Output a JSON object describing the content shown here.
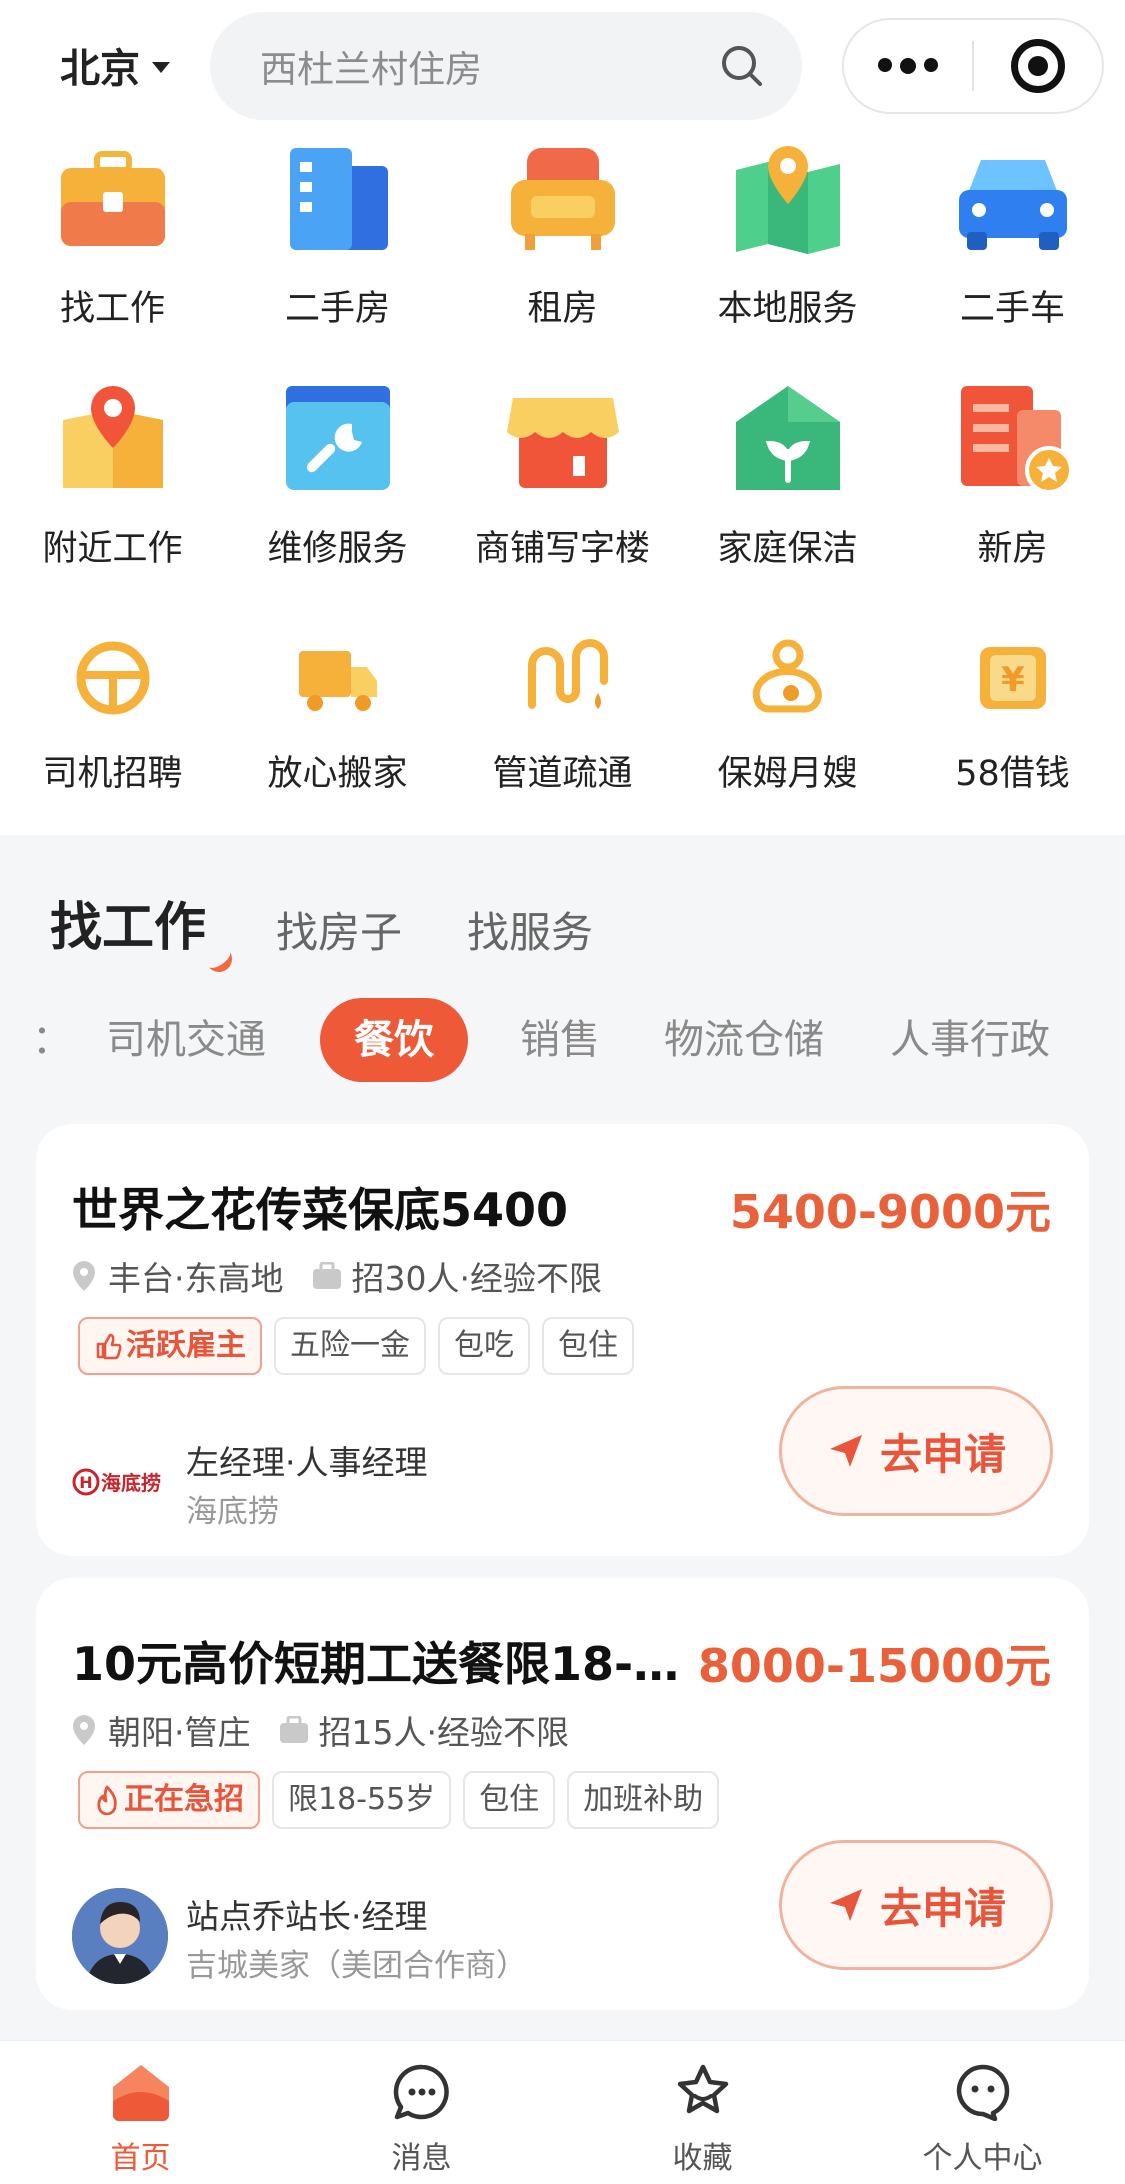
{
  "header": {
    "city": "北京",
    "search_placeholder": "西杜兰村住房"
  },
  "services": [
    {
      "label": "找工作",
      "icon": "briefcase-icon"
    },
    {
      "label": "二手房",
      "icon": "building-icon"
    },
    {
      "label": "租房",
      "icon": "armchair-icon"
    },
    {
      "label": "本地服务",
      "icon": "map-pin-icon"
    },
    {
      "label": "二手车",
      "icon": "car-icon"
    },
    {
      "label": "附近工作",
      "icon": "location-map-icon"
    },
    {
      "label": "维修服务",
      "icon": "wrench-icon"
    },
    {
      "label": "商铺写字楼",
      "icon": "storefront-icon"
    },
    {
      "label": "家庭保洁",
      "icon": "house-sprout-icon"
    },
    {
      "label": "新房",
      "icon": "new-house-star-icon"
    },
    {
      "label": "司机招聘",
      "icon": "steering-wheel-icon"
    },
    {
      "label": "放心搬家",
      "icon": "truck-icon"
    },
    {
      "label": "管道疏通",
      "icon": "pipe-icon"
    },
    {
      "label": "保姆月嫂",
      "icon": "nanny-icon"
    },
    {
      "label": "58借钱",
      "icon": "yuan-card-icon"
    }
  ],
  "section_tabs": {
    "main": "找工作",
    "second": "找房子",
    "third": "找服务"
  },
  "categories": {
    "partial": "：",
    "items": [
      "司机交通",
      "餐饮",
      "销售",
      "物流仓储",
      "人事行政"
    ],
    "active": "餐饮"
  },
  "jobs": [
    {
      "title": "世界之花传菜保底5400",
      "salary": "5400-9000元",
      "location": "丰台·东高地",
      "recruit": "招30人·经验不限",
      "badge": "活跃雇主",
      "tags": [
        "五险一金",
        "包吃",
        "包住"
      ],
      "contact": "左经理·人事经理",
      "company": "海底捞",
      "logo_text": "海底捞",
      "apply": "去申请"
    },
    {
      "title": "10元高价短期工送餐限18-…",
      "salary": "8000-15000元",
      "location": "朝阳·管庄",
      "recruit": "招15人·经验不限",
      "badge": "正在急招",
      "tags": [
        "限18-55岁",
        "包住",
        "加班补助"
      ],
      "contact": "站点乔站长·经理",
      "company": "吉城美家（美团合作商）",
      "apply": "去申请"
    }
  ],
  "tabbar": [
    {
      "label": "首页",
      "icon": "home-icon"
    },
    {
      "label": "消息",
      "icon": "message-icon"
    },
    {
      "label": "收藏",
      "icon": "star-icon"
    },
    {
      "label": "个人中心",
      "icon": "user-center-icon"
    }
  ],
  "colors": {
    "accent": "#ee5a37",
    "salary": "#e8613a",
    "background": "#f5f6f8"
  }
}
